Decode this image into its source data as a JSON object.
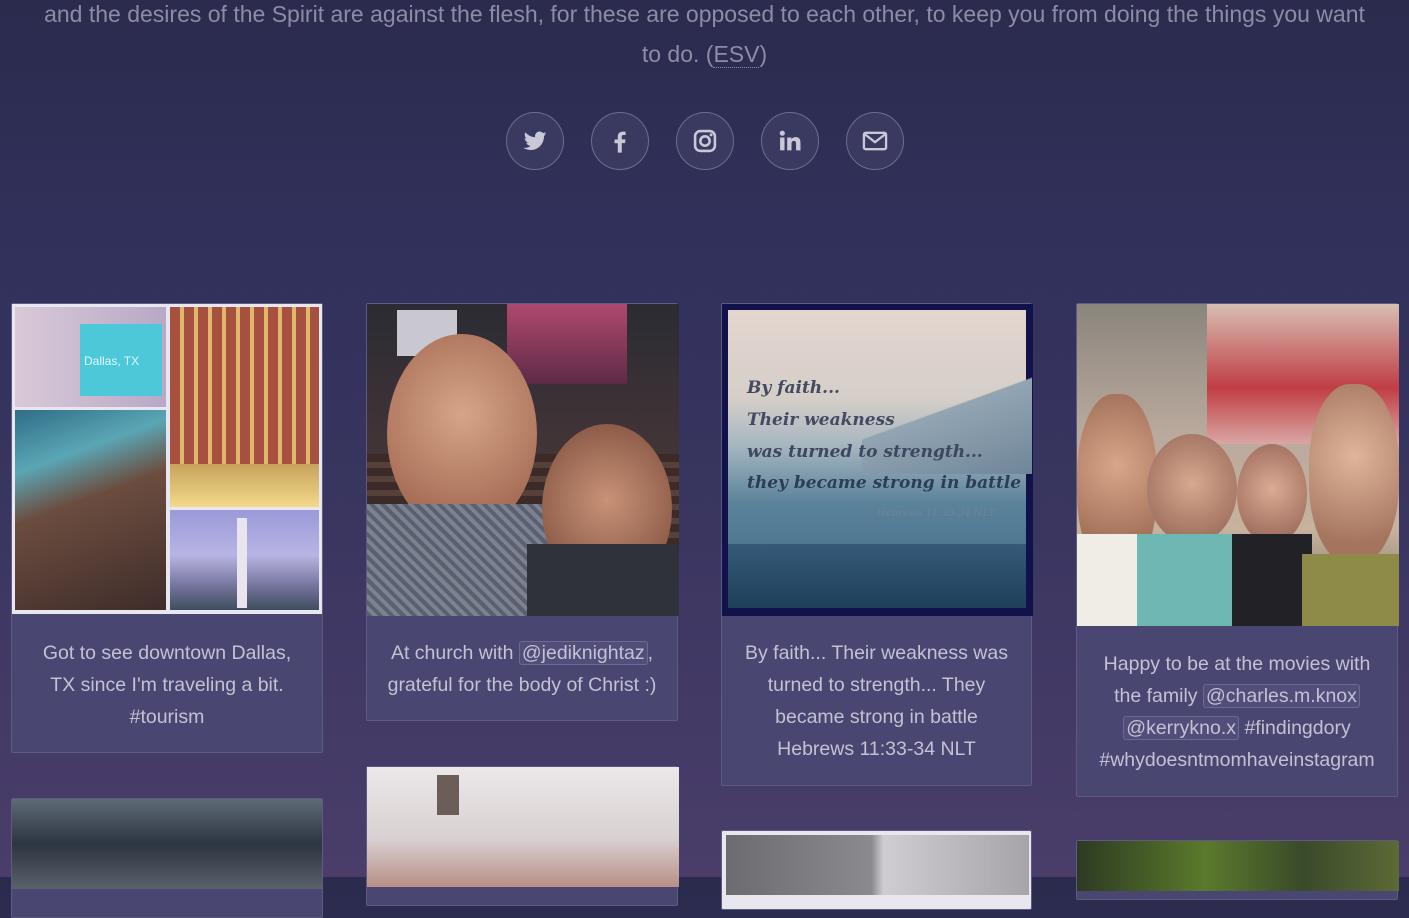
{
  "verse": {
    "line1": "and the desires of the Spirit are against the flesh, for these are opposed to each other, to keep you from doing the things you want",
    "line2_prefix": "to do. (",
    "version": "ESV",
    "line2_suffix": ")"
  },
  "social": [
    {
      "name": "twitter-icon"
    },
    {
      "name": "facebook-icon"
    },
    {
      "name": "instagram-icon"
    },
    {
      "name": "linkedin-icon"
    },
    {
      "name": "email-icon"
    }
  ],
  "posts": [
    {
      "caption": "Got to see downtown Dallas, TX since I'm traveling a bit. #tourism",
      "photo_sign": "Dallas, TX"
    },
    {
      "caption_prefix": "At church with ",
      "mention": "@jediknightaz",
      "caption_suffix": ", grateful for the body of Christ :)"
    },
    {
      "caption": "By faith... Their weakness was turned to strength... They became strong in battle Hebrews 11:33-34 NLT",
      "photo_lines": [
        "By faith...",
        "Their weakness",
        "was turned to strength...",
        "they became strong in battle"
      ],
      "photo_ref": "Hebrews 11:33-34 NLT"
    },
    {
      "caption_prefix": "Happy to be at the movies with the family ",
      "mention1": "@charles.m.knox",
      "mention2": "@kerrykno.x",
      "caption_suffix": " #findingdory #whydoesntmomhaveinstagram"
    }
  ],
  "colors": {
    "background": "#30305a",
    "card": "#4a4672",
    "caption_text": "#c3c1d3"
  }
}
